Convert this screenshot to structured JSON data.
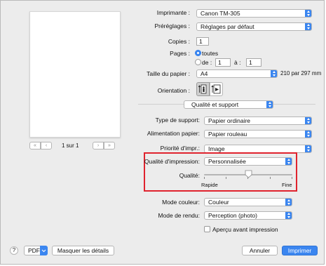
{
  "printer": {
    "label": "Imprimante :",
    "value": "Canon TM-305"
  },
  "presets": {
    "label": "Préréglages :",
    "value": "Réglages par défaut"
  },
  "copies": {
    "label": "Copies :",
    "value": "1"
  },
  "pages": {
    "label": "Pages :",
    "all": "toutes",
    "from_label": "de :",
    "from_value": "1",
    "to_label": "à :",
    "to_value": "1"
  },
  "paper_size": {
    "label": "Taille du papier :",
    "value": "A4",
    "dimensions": "210 par 297 mm"
  },
  "orientation": {
    "label": "Orientation :"
  },
  "section_menu": {
    "value": "Qualité et support"
  },
  "media_type": {
    "label": "Type de support:",
    "value": "Papier ordinaire"
  },
  "paper_source": {
    "label": "Alimentation papier:",
    "value": "Papier rouleau"
  },
  "print_priority": {
    "label": "Priorité d'impr.:",
    "value": "Image"
  },
  "print_quality": {
    "label": "Qualité d'impression:",
    "value": "Personnalisée"
  },
  "quality_slider": {
    "label": "Qualité:",
    "min_label": "Rapide",
    "max_label": "Fine",
    "level": 0.5
  },
  "color_mode": {
    "label": "Mode couleur:",
    "value": "Couleur"
  },
  "render_mode": {
    "label": "Mode de rendu:",
    "value": "Perception (photo)"
  },
  "preview_checkbox": {
    "label": "Aperçu avant impression",
    "checked": false
  },
  "pager": {
    "text": "1 sur 1"
  },
  "footer": {
    "help": "?",
    "pdf": "PDF",
    "hide_details": "Masquer les détails",
    "cancel": "Annuler",
    "print": "Imprimer"
  },
  "colors": {
    "accent": "#3b86f0",
    "highlight": "#e0232e"
  }
}
